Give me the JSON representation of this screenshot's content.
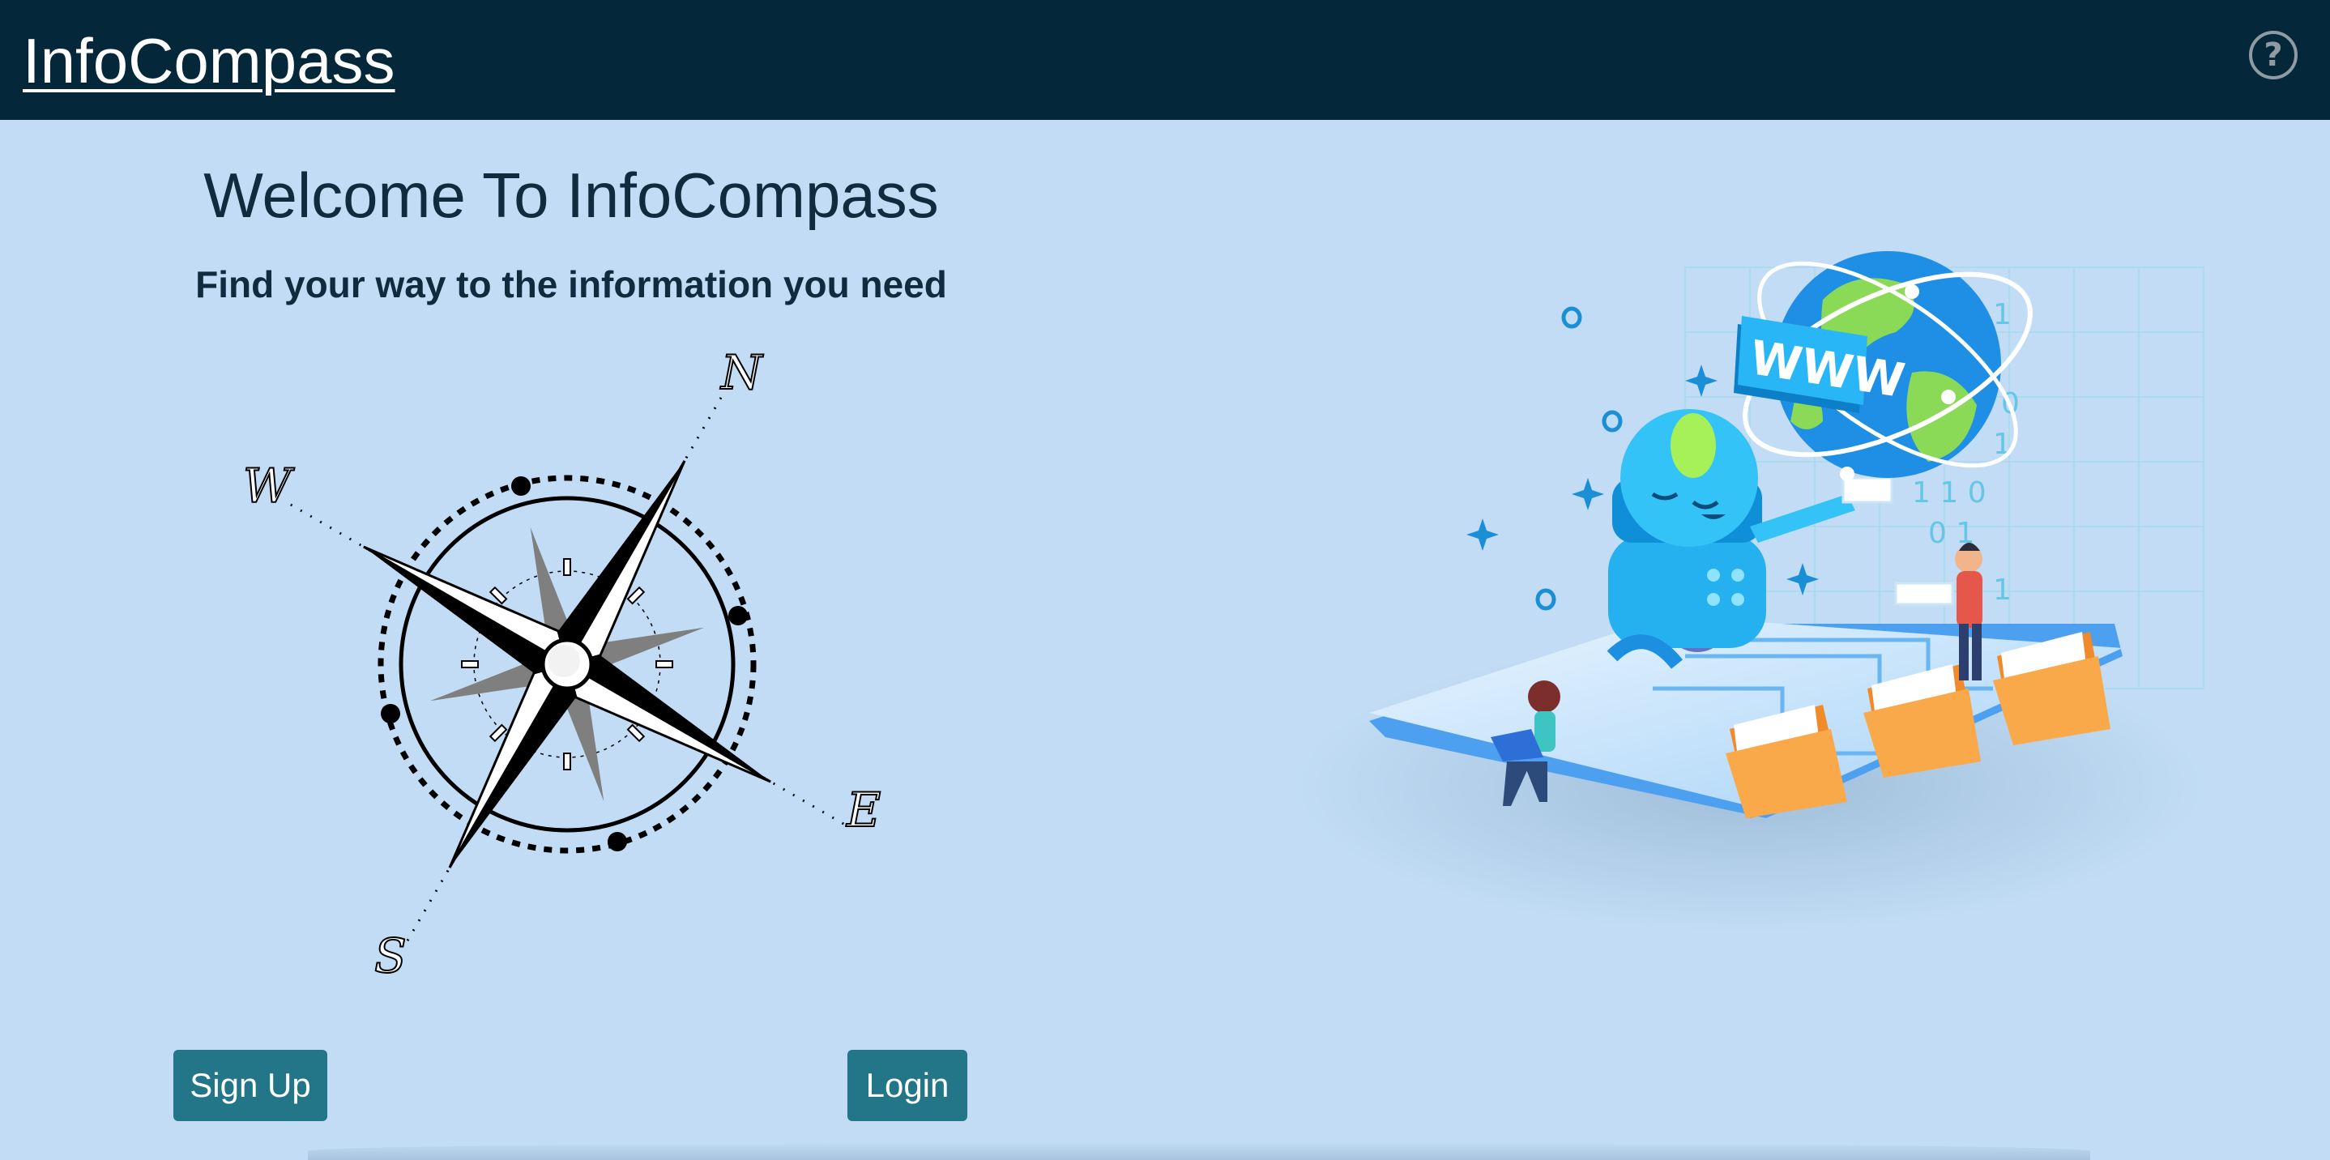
{
  "header": {
    "brand": "InfoCompass",
    "help_icon": "question-circle-icon",
    "help_glyph": "?"
  },
  "main": {
    "title": "Welcome To InfoCompass",
    "subtitle": "Find your way to the information you need"
  },
  "compass": {
    "labels": {
      "north": "N",
      "east": "E",
      "south": "S",
      "west": "W"
    }
  },
  "illustration": {
    "sign_text": "WWW",
    "binary": [
      "1",
      "0",
      "1",
      "1",
      "1 1 0",
      "0 1",
      "1"
    ]
  },
  "actions": {
    "signup_label": "Sign Up",
    "login_label": "Login"
  },
  "colors": {
    "header_bg": "#04273a",
    "page_bg": "#c1dcf4",
    "button_bg": "#227688",
    "title_text": "#0f2b3d"
  }
}
